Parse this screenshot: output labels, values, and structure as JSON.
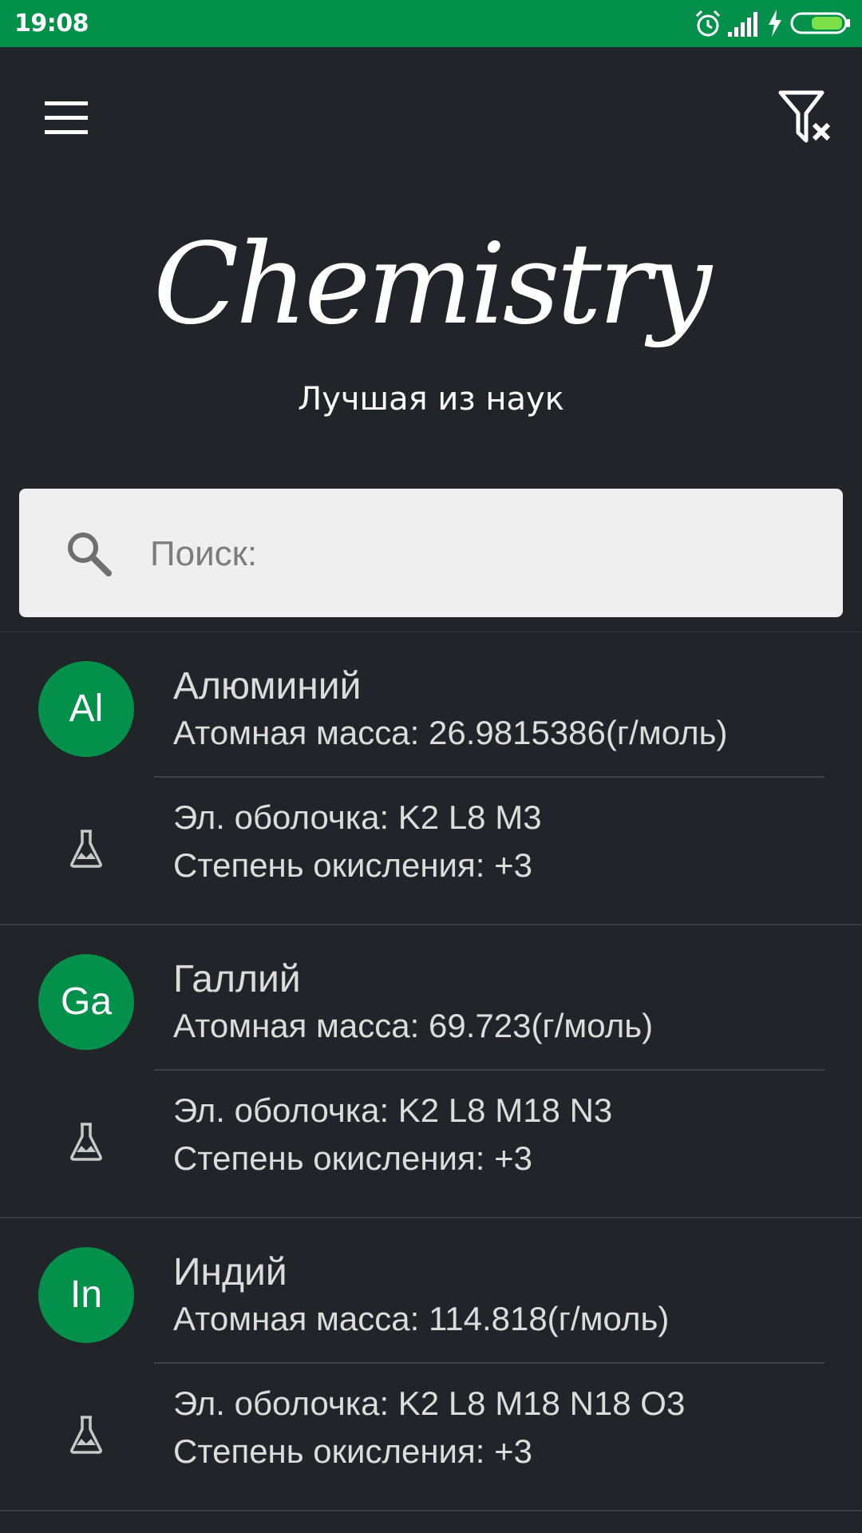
{
  "status_bar": {
    "time": "19:08",
    "icons": [
      "alarm-icon",
      "signal-icon",
      "charging-icon",
      "battery-icon"
    ],
    "color": "#03904a"
  },
  "toolbar": {
    "menu_icon": "hamburger-menu-icon",
    "filter_icon": "filter-clear-icon"
  },
  "logo": {
    "title": "Chemistry",
    "subtitle": "Лучшая из наук"
  },
  "search": {
    "placeholder": "Поиск:",
    "value": "",
    "icon": "search-icon"
  },
  "elements": [
    {
      "symbol": "Al",
      "name": "Алюминий",
      "mass": "Атомная масса: 26.9815386(г/моль)",
      "shell": "Эл. оболочка: K2 L8 M3",
      "oxidation": "Степень окисления: +3"
    },
    {
      "symbol": "Ga",
      "name": "Галлий",
      "mass": "Атомная масса: 69.723(г/моль)",
      "shell": "Эл. оболочка: K2 L8 M18 N3",
      "oxidation": "Степень окисления: +3"
    },
    {
      "symbol": "In",
      "name": "Индий",
      "mass": "Атомная масса: 114.818(г/моль)",
      "shell": "Эл. оболочка: K2 L8 M18 N18 O3",
      "oxidation": "Степень окисления: +3"
    }
  ],
  "colors": {
    "accent": "#03904a",
    "background": "#212429",
    "search_bg": "#efefef"
  }
}
